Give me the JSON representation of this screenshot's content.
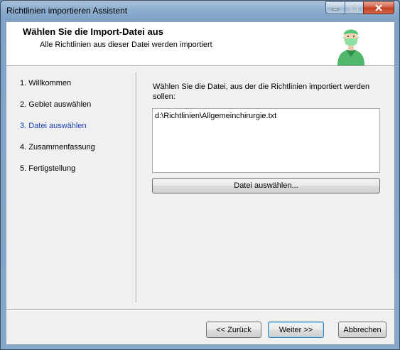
{
  "window": {
    "title": "Richtlinien importieren Assistent"
  },
  "header": {
    "title": "Wählen Sie die Import-Datei aus",
    "subtitle": "Alle Richtlinien aus dieser Datei werden importiert",
    "icon": "surgeon-icon"
  },
  "steps": [
    {
      "label": "1. Willkommen",
      "active": false
    },
    {
      "label": "2. Gebiet auswählen",
      "active": false
    },
    {
      "label": "3. Datei auswählen",
      "active": true
    },
    {
      "label": "4. Zusammenfassung",
      "active": false
    },
    {
      "label": "5. Fertigstellung",
      "active": false
    }
  ],
  "main": {
    "prompt": "Wählen Sie die Datei, aus der die Richtlinien importiert werden sollen:",
    "file_path": "d:\\Richtlinien\\Allgemeinchirurgie.txt",
    "choose_button": "Datei auswählen..."
  },
  "footer": {
    "back_label": "<< Zurück",
    "next_label": "Weiter >>",
    "cancel_label": "Abbrechen"
  },
  "colors": {
    "active_step": "#1a3fb3",
    "close_button": "#c23d22"
  }
}
